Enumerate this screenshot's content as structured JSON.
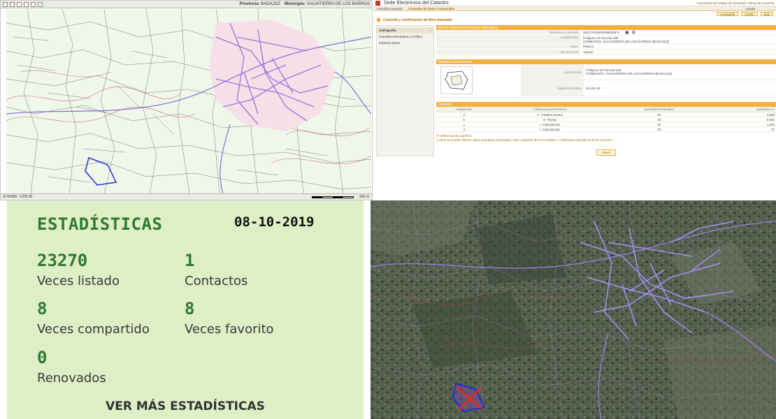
{
  "map_viewer": {
    "toolbar": {
      "provincia_label": "Provincia:",
      "provincia_value": "BADAJOZ",
      "municipio_label": "Municipio:",
      "municipio_value": "SALVATIERRA DE LOS BARROS"
    },
    "status": {
      "projection": "ETRS89 · UTM 29",
      "scale_label": "200 m"
    }
  },
  "catastro": {
    "site_title": "Sede Electrónica del Catastro",
    "top_links": "• Secretaría de Estado de Hacienda   • Dirección General",
    "nav": {
      "inicio": "Inicio/Documentar",
      "consulta": "Consulta de Datos Catastrales",
      "help": "Ayuda"
    },
    "subbar": {
      "btn1": "Cartografía",
      "btn2": "Listado",
      "btn3": "Salir"
    },
    "page_title": "Consulta y certificación de Bien Inmueble",
    "sidebar": {
      "items": [
        {
          "label": "Cartografía"
        },
        {
          "label": "Consulta Descriptiva y Gráfica"
        },
        {
          "label": "Imprimir Datos"
        }
      ]
    },
    "datos": {
      "section_title": "DATOS DESCRIPTIVOS DEL INMUEBLE",
      "ref_label": "Referencia catastral",
      "ref_value": "06117A016001650000FS",
      "loc_label": "Localización",
      "loc_value1": "Polígono 16 Parcela 165",
      "loc_value2": "CORBANTO. SALVATIERRA DE LOS BARROS (BADAJOZ)",
      "clase_label": "Clase",
      "clase_value": "Rústico",
      "uso_label": "Uso principal",
      "uso_value": "Agrario"
    },
    "parcela": {
      "section_title": "PARCELA CATASTRAL",
      "loc_label": "Localización",
      "loc_value1": "Polígono 16 Parcela 165",
      "loc_value2": "CORBANTO. SALVATIERRA DE LOS BARROS (BADAJOZ)",
      "sup_label": "Superficie gráfica",
      "sup_value": "16.431 m²"
    },
    "cultivos": {
      "section_title": "CULTIVO",
      "headers": [
        "Subparcela",
        "Cultivo/Aprovechamiento",
        "Intensidad Productiva",
        "Superficie m²"
      ],
      "rows": [
        [
          "a",
          "F- Frutales secano",
          "00",
          "3.538"
        ],
        [
          "b",
          "E- Pastos",
          "00",
          "8.662"
        ],
        [
          "c",
          "I- Improductivo",
          "00",
          "1.204"
        ],
        [
          "d",
          "I- Improductivo",
          "00",
          "27"
        ]
      ]
    },
    "notes": {
      "note1": "(*) Diferencia de superficie",
      "note2": "¿Cómo se pueden obtener datos protegidos (titularidad y valor catastral) de los inmuebles o certificados telemáticos de los mismos?"
    },
    "volver": "Volver"
  },
  "stats": {
    "title": "ESTADÍSTICAS",
    "date": "08-10-2019",
    "items": [
      {
        "value": "23270",
        "label": "Veces listado"
      },
      {
        "value": "1",
        "label": "Contactos"
      },
      {
        "value": "8",
        "label": "Veces compartido"
      },
      {
        "value": "8",
        "label": "Veces favorito"
      },
      {
        "value": "0",
        "label": "Renovados"
      }
    ],
    "more": "VER MÁS ESTADÍSTICAS"
  },
  "colors": {
    "stats_bg": "#deeec5",
    "stats_green": "#2f7a30",
    "catastro_orange": "#f2b13d",
    "parcel_blue": "#2b2bd6",
    "urban_lilac": "#b9a0e6"
  }
}
